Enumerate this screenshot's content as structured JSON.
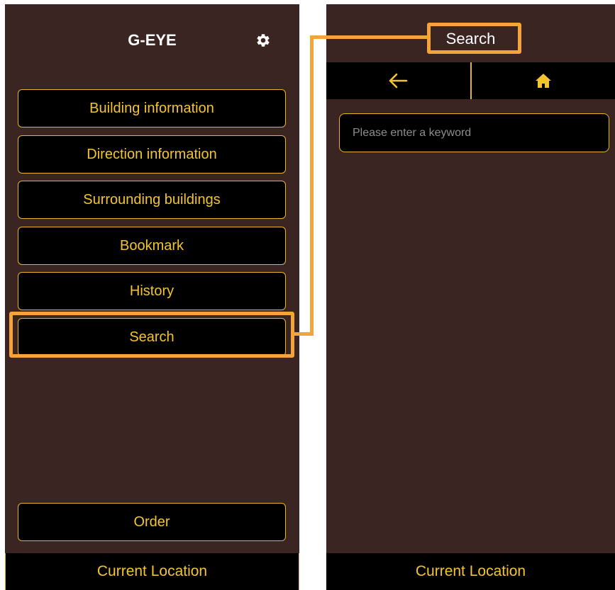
{
  "colors": {
    "panel_bg": "#3a2522",
    "accent": "#f4c430",
    "highlight": "#f5a33b",
    "button_bg": "#000000"
  },
  "left_screen": {
    "title": "G-EYE",
    "settings_icon": "gear-icon",
    "menu": [
      {
        "label": "Building information"
      },
      {
        "label": "Direction information"
      },
      {
        "label": "Surrounding buildings"
      },
      {
        "label": "Bookmark"
      },
      {
        "label": "History"
      },
      {
        "label": "Search"
      }
    ],
    "order_label": "Order",
    "footer_label": "Current Location"
  },
  "right_screen": {
    "title": "Search",
    "back_icon": "arrow-left-icon",
    "home_icon": "home-icon",
    "search": {
      "placeholder": "Please enter a keyword",
      "value": ""
    },
    "footer_label": "Current Location"
  }
}
